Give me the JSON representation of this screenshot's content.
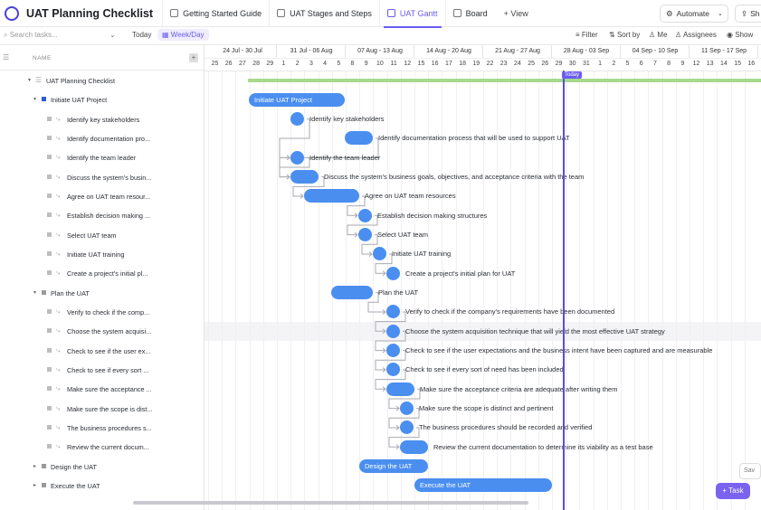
{
  "app": {
    "title": "UAT Planning Checklist"
  },
  "tabs": [
    {
      "label": "Getting Started Guide",
      "icon": "doc-icon"
    },
    {
      "label": "UAT Stages and Steps",
      "icon": "list-icon"
    },
    {
      "label": "UAT Gantt",
      "icon": "gantt-icon",
      "active": true
    },
    {
      "label": "Board",
      "icon": "board-icon"
    }
  ],
  "add_view": "+ View",
  "automate": "Automate",
  "share": "Sh",
  "toolbar": {
    "search_placeholder": "Search tasks...",
    "today": "Today",
    "week_day": "Week/Day",
    "filter": "Filter",
    "sort_by": "Sort by",
    "me": "Me",
    "assignees": "Assignees",
    "show": "Show"
  },
  "list": {
    "name_header": "NAME",
    "rows": [
      {
        "label": "UAT Planning Checklist",
        "kind": "list"
      },
      {
        "label": "Initiate UAT Project",
        "kind": "group"
      },
      {
        "label": "Identify key stakeholders",
        "kind": "task"
      },
      {
        "label": "Identify documentation pro...",
        "kind": "task"
      },
      {
        "label": "Identify the team leader",
        "kind": "task"
      },
      {
        "label": "Discuss the system's busin...",
        "kind": "task"
      },
      {
        "label": "Agree on UAT team resour...",
        "kind": "task"
      },
      {
        "label": "Establish decision making ...",
        "kind": "task"
      },
      {
        "label": "Select UAT team",
        "kind": "task"
      },
      {
        "label": "Initiate UAT training",
        "kind": "task"
      },
      {
        "label": "Create a project's initial pl...",
        "kind": "task"
      },
      {
        "label": "Plan the UAT",
        "kind": "group"
      },
      {
        "label": "Verify to check if the comp...",
        "kind": "task"
      },
      {
        "label": "Choose the system acquisi...",
        "kind": "task"
      },
      {
        "label": "Check to see if the user ex...",
        "kind": "task"
      },
      {
        "label": "Check to see if every sort ...",
        "kind": "task"
      },
      {
        "label": "Make sure the acceptance ...",
        "kind": "task"
      },
      {
        "label": "Make sure the scope is dist...",
        "kind": "task"
      },
      {
        "label": "The business procedures s...",
        "kind": "task"
      },
      {
        "label": "Review the current docum...",
        "kind": "task"
      },
      {
        "label": "Design the UAT",
        "kind": "group-collapsed"
      },
      {
        "label": "Execute the UAT",
        "kind": "group-collapsed"
      }
    ]
  },
  "gantt": {
    "weeks": [
      "24 Jul - 30 Jul",
      "31 Jul - 06 Aug",
      "07 Aug - 13 Aug",
      "14 Aug - 20 Aug",
      "21 Aug - 27 Aug",
      "28 Aug - 03 Sep",
      "04 Sep - 10 Sep",
      "11 Sep - 17 Sep"
    ],
    "days": [
      "25",
      "26",
      "27",
      "28",
      "29",
      "1",
      "2",
      "3",
      "4",
      "5",
      "8",
      "9",
      "10",
      "11",
      "12",
      "15",
      "16",
      "17",
      "18",
      "19",
      "22",
      "23",
      "24",
      "25",
      "26",
      "29",
      "30",
      "31",
      "1",
      "2",
      "5",
      "6",
      "7",
      "8",
      "9",
      "12",
      "13",
      "14",
      "15",
      "16"
    ],
    "today_label": "Today",
    "bars": [
      {
        "row": 1,
        "label": "Initiate UAT Project",
        "in_bar": true
      },
      {
        "row": 2,
        "label": "Identify key stakeholders"
      },
      {
        "row": 3,
        "label": "Identify documentation process that will be used to support UAT"
      },
      {
        "row": 4,
        "label": "Identify the team leader"
      },
      {
        "row": 5,
        "label": "Discuss the system's business goals, objectives, and acceptance criteria with the team"
      },
      {
        "row": 6,
        "label": "Agree on UAT team resources"
      },
      {
        "row": 7,
        "label": "Establish decision making structures"
      },
      {
        "row": 8,
        "label": "Select UAT team"
      },
      {
        "row": 9,
        "label": "Initiate UAT training"
      },
      {
        "row": 10,
        "label": "Create a project's initial plan for UAT"
      },
      {
        "row": 11,
        "label": "Plan the UAT"
      },
      {
        "row": 12,
        "label": "Verify to check if the company's requirements have been documented"
      },
      {
        "row": 13,
        "label": "Choose the system acquisition technique that will yield the most effective UAT strategy"
      },
      {
        "row": 14,
        "label": "Check to see if the user expectations and the business intent have been captured and are measurable"
      },
      {
        "row": 15,
        "label": "Check to see if every sort of need has been included"
      },
      {
        "row": 16,
        "label": "Make sure the acceptance criteria are adequate after writing them"
      },
      {
        "row": 17,
        "label": "Make sure the scope is distinct and pertinent"
      },
      {
        "row": 18,
        "label": "The business procedures should be recorded and verified"
      },
      {
        "row": 19,
        "label": "Review the current documentation to determine its viability as a test base"
      },
      {
        "row": 20,
        "label": "Design the UAT",
        "in_bar": true
      },
      {
        "row": 21,
        "label": "Execute the UAT",
        "in_bar": true
      }
    ]
  },
  "fab": {
    "task": "Task",
    "save": "Sav"
  },
  "colors": {
    "accent": "#6b5cf0",
    "bar": "#4a8ef0",
    "progress": "#a7d98c"
  }
}
